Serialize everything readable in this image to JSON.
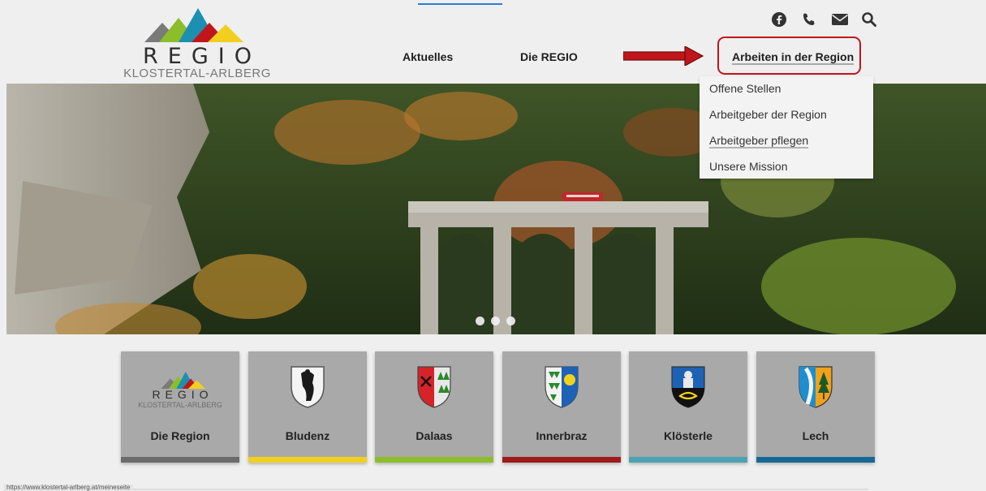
{
  "logo": {
    "title": "REGIO",
    "subtitle": "KLOSTERTAL-ARLBERG"
  },
  "header_icons": [
    "facebook-icon",
    "phone-icon",
    "mail-icon",
    "search-icon"
  ],
  "nav": {
    "aktuelles": "Aktuelles",
    "die_regio": "Die REGIO",
    "arbeiten": "Arbeiten in der Region"
  },
  "dropdown": {
    "items": [
      "Offene Stellen",
      "Arbeitgeber der Region",
      "Arbeitgeber pflegen",
      "Unsere Mission"
    ]
  },
  "tiles": [
    {
      "label": "Die Region",
      "bar_color": "#6b6b6b"
    },
    {
      "label": "Bludenz",
      "bar_color": "#f2cf1f"
    },
    {
      "label": "Dalaas",
      "bar_color": "#8cbe2b"
    },
    {
      "label": "Innerbraz",
      "bar_color": "#9f1a1a"
    },
    {
      "label": "Klösterle",
      "bar_color": "#4aa3b1"
    },
    {
      "label": "Lech",
      "bar_color": "#156a95"
    }
  ],
  "tile_logo": {
    "title": "REGIO",
    "subtitle": "KLOSTERTAL-ARLBERG"
  },
  "slider": {
    "dot_count": 3
  },
  "status_url": "https://www.klostertal-arlberg.at/meineseite",
  "colors": {
    "highlight": "#c0161b",
    "arrow": "#c0161b"
  }
}
